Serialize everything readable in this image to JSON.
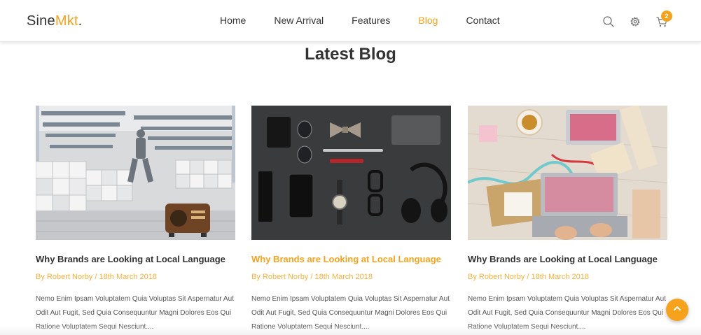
{
  "brand": {
    "part1": "Sine",
    "part2": "Mkt",
    "dot": "."
  },
  "nav": {
    "items": [
      {
        "label": "Home"
      },
      {
        "label": "New Arrival"
      },
      {
        "label": "Features"
      },
      {
        "label": "Blog"
      },
      {
        "label": "Contact"
      }
    ],
    "active": "Blog"
  },
  "header_icons": [
    "search-icon",
    "gear-icon",
    "cart-icon"
  ],
  "cart": {
    "count": "2"
  },
  "section": {
    "title": "Latest Blog"
  },
  "posts": [
    {
      "image": "store-interior-photo",
      "title": "Why Brands are Looking at Local Language",
      "meta": "By Robert Norby / 18th March 2018",
      "excerpt": "Nemo Enim Ipsam Voluptatem Quia Voluptas Sit Aspernatur Aut Odit Aut Fugit, Sed Quia Consequuntur Magni Dolores Eos Qui Ratione Voluptatem Sequi Nesciunt...."
    },
    {
      "image": "accessories-flatlay-photo",
      "title": "Why Brands are Looking at Local Language",
      "meta": "By Robert Norby / 18th March 2018",
      "excerpt": "Nemo Enim Ipsam Voluptatem Quia Voluptas Sit Aspernatur Aut Odit Aut Fugit, Sed Quia Consequuntur Magni Dolores Eos Qui Ratione Voluptatem Sequi Nesciunt...."
    },
    {
      "image": "desk-laptop-photo",
      "title": "Why Brands are Looking at Local Language",
      "meta": "By Robert Norby / 18th March 2018",
      "excerpt": "Nemo Enim Ipsam Voluptatem Quia Voluptas Sit Aspernatur Aut Odit Aut Fugit, Sed Quia Consequuntur Magni Dolores Eos Qui Ratione Voluptatem Sequi Nesciunt...."
    }
  ],
  "colors": {
    "accent": "#f7a21b",
    "text": "#333333"
  },
  "scroll_top_icon": "chevron-up-icon"
}
